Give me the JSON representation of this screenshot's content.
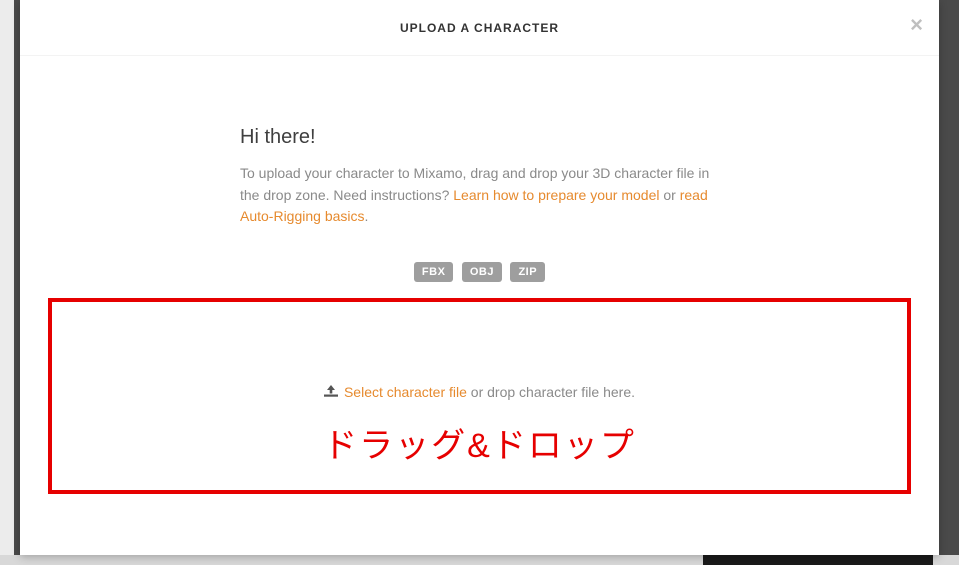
{
  "modal": {
    "title": "UPLOAD A CHARACTER",
    "close_label": "×"
  },
  "intro": {
    "heading": "Hi there!",
    "text_pre": "To upload your character to Mixamo, drag and drop your 3D character file in the drop zone. Need instructions? ",
    "link1": "Learn how to prepare your model",
    "text_mid": " or ",
    "link2": "read Auto-Rigging basics",
    "text_post": "."
  },
  "formats": {
    "items": [
      "FBX",
      "OBJ",
      "ZIP"
    ]
  },
  "dropzone": {
    "select_link": "Select character file",
    "suffix": " or drop character file here."
  },
  "annotations": {
    "jp_overlay": "ドラッグ&ドロップ"
  }
}
